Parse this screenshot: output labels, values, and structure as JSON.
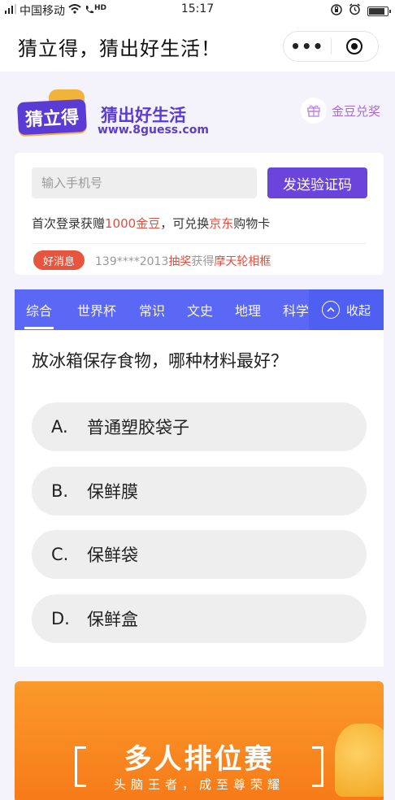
{
  "statusbar": {
    "carrier": "中国移动",
    "time": "15:17",
    "signal_tag": "HD",
    "battery_level": 0.9
  },
  "titlebar": {
    "title": "猜立得，猜出好生活！",
    "more_label": "•••"
  },
  "brand": {
    "logo_text": "猜立得",
    "slogan": "猜出好生活",
    "url": "www.8guess.com",
    "gift_label": "金豆兑奖"
  },
  "login": {
    "phone_placeholder": "输入手机号",
    "send_code_label": "发送验证码",
    "promo_prefix": "首次登录获赠",
    "promo_amount": "1000金豆",
    "promo_middle": "，可兑换",
    "promo_brand": "京东",
    "promo_suffix": "购物卡",
    "news_badge": "好消息",
    "news_user": "139****2013",
    "news_action": "抽奖",
    "news_verb": "获得",
    "news_prize": "摩天轮相框"
  },
  "tabs": {
    "items": [
      "综合",
      "世界杯",
      "常识",
      "文史",
      "地理",
      "科学"
    ],
    "collapse_label": "收起"
  },
  "question": {
    "text": "放冰箱保存食物，哪种材料最好？",
    "options": [
      {
        "letter": "A.",
        "text": "普通塑胶袋子"
      },
      {
        "letter": "B.",
        "text": "保鲜膜"
      },
      {
        "letter": "C.",
        "text": "保鲜袋"
      },
      {
        "letter": "D.",
        "text": "保鲜盒"
      }
    ]
  },
  "banner": {
    "title": "多人排位赛",
    "subtitle": "头脑王者，成至尊荣耀"
  },
  "colors": {
    "brand_purple": "#5b3bd6",
    "tab_blue": "#5b67f5",
    "highlight_red": "#e74c3c",
    "banner_orange": "#f88a22"
  }
}
